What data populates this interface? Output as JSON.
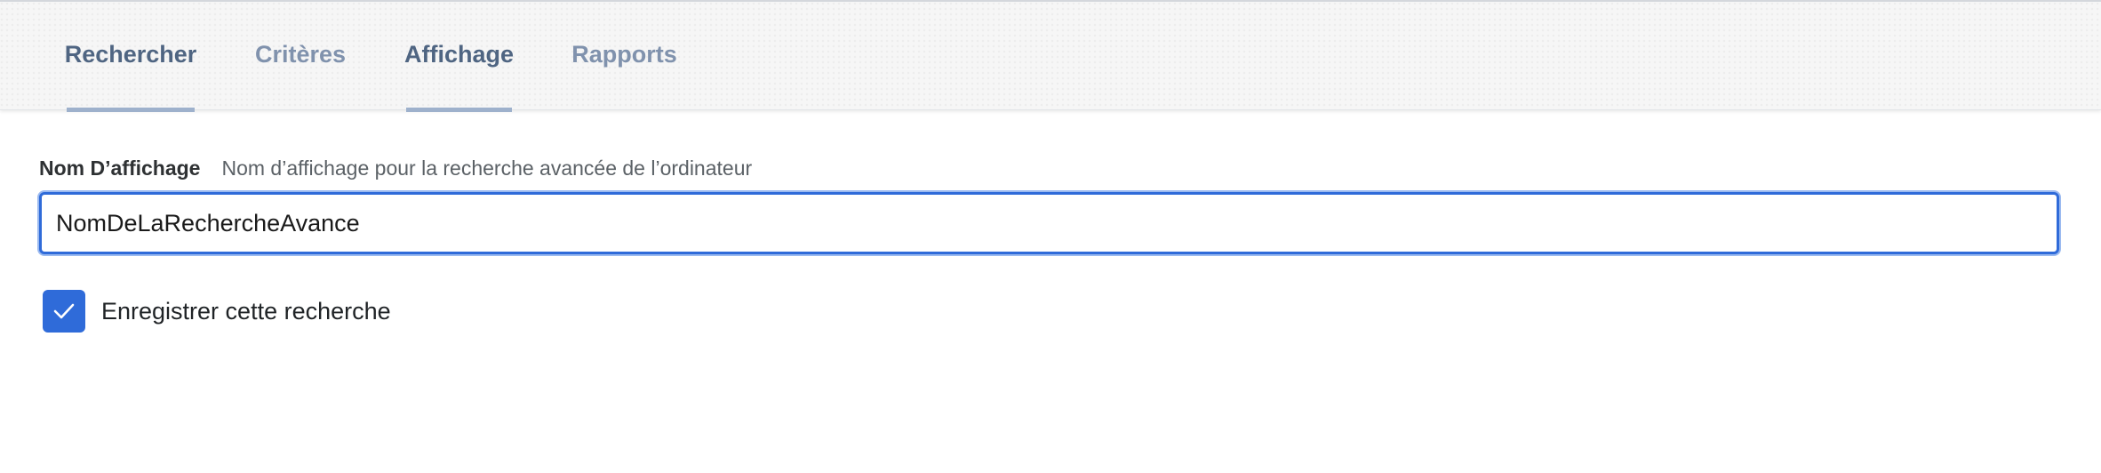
{
  "tabs": [
    {
      "label": "Rechercher",
      "active": true
    },
    {
      "label": "Critères",
      "active": false
    },
    {
      "label": "Affichage",
      "active": true
    },
    {
      "label": "Rapports",
      "active": false
    }
  ],
  "display_name": {
    "label": "Nom D’affichage",
    "help": "Nom d’affichage pour la recherche avancée de l’ordinateur",
    "value": "NomDeLaRechercheAvance"
  },
  "save_search": {
    "label": "Enregistrer cette recherche",
    "checked": true,
    "icon": "checkmark-icon"
  },
  "colors": {
    "accent": "#2f6bd9",
    "tab_active": "#4f6582",
    "tab_inactive": "#8092ad",
    "tab_underline": "#9eb1cc"
  }
}
